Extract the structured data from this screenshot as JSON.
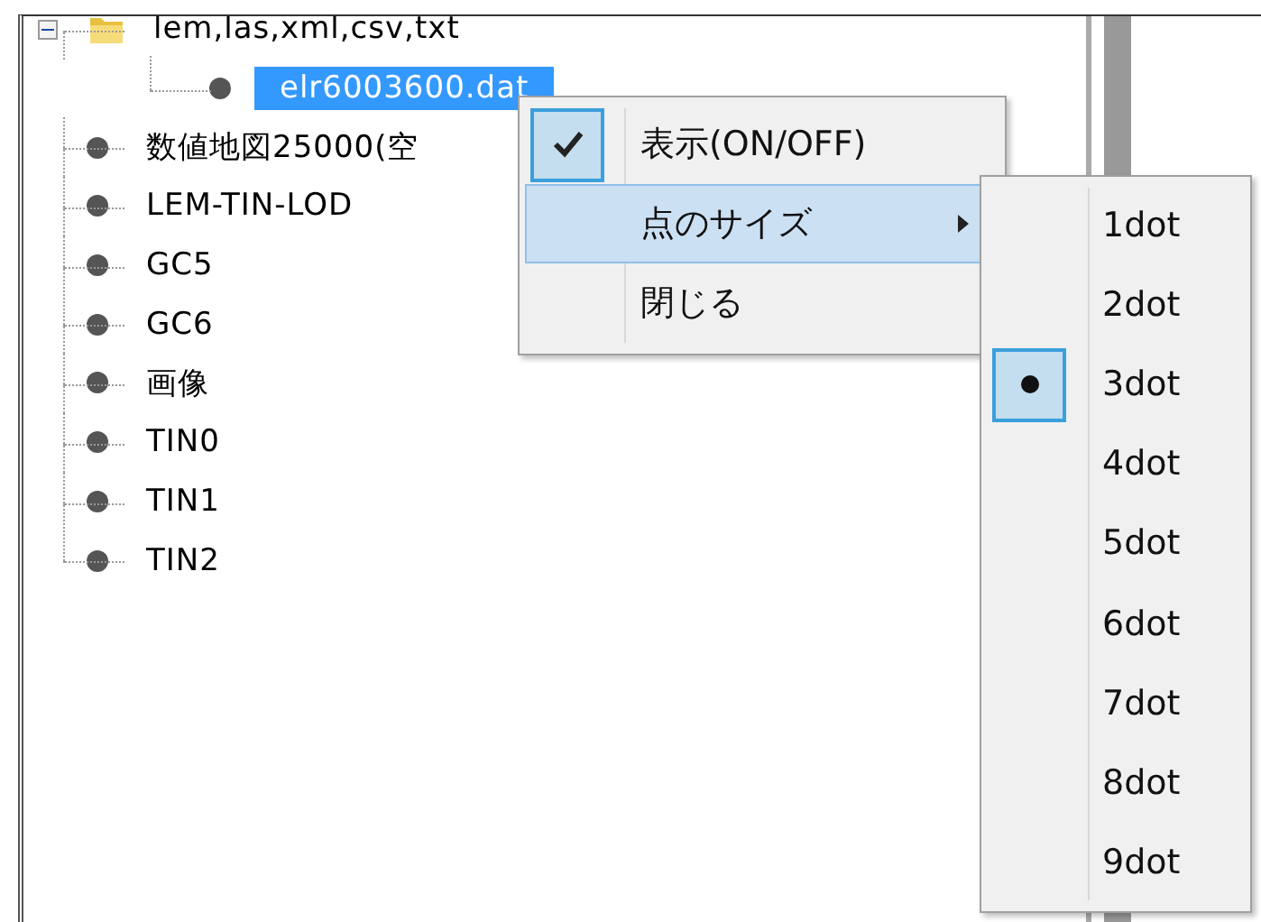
{
  "tree": [
    {
      "kind": "folder",
      "label": "lem,las,xml,csv,txt",
      "expanded": true,
      "selected": false,
      "children": [
        {
          "kind": "layer",
          "label": "elr6003600.dat",
          "selected": true
        }
      ]
    },
    {
      "kind": "layer",
      "label": "数値地図25000(空",
      "selected": false
    },
    {
      "kind": "layer",
      "label": "LEM-TIN-LOD",
      "selected": false
    },
    {
      "kind": "layer",
      "label": "GC5",
      "selected": false
    },
    {
      "kind": "layer",
      "label": "GC6",
      "selected": false
    },
    {
      "kind": "layer",
      "label": "画像",
      "selected": false
    },
    {
      "kind": "layer",
      "label": "TIN0",
      "selected": false
    },
    {
      "kind": "layer",
      "label": "TIN1",
      "selected": false
    },
    {
      "kind": "layer",
      "label": "TIN2",
      "selected": false
    }
  ],
  "context_menu": {
    "items": [
      {
        "label": "表示(ON/OFF)",
        "checked": true,
        "selected": false,
        "submenu": false
      },
      {
        "label": "点のサイズ",
        "checked": false,
        "selected": true,
        "submenu": true
      },
      {
        "label": "閉じる",
        "checked": false,
        "selected": false,
        "submenu": false
      }
    ]
  },
  "submenu": {
    "items": [
      {
        "label": "1dot",
        "selected": false
      },
      {
        "label": "2dot",
        "selected": false
      },
      {
        "label": "3dot",
        "selected": true
      },
      {
        "label": "4dot",
        "selected": false
      },
      {
        "label": "5dot",
        "selected": false
      },
      {
        "label": "6dot",
        "selected": false
      },
      {
        "label": "7dot",
        "selected": false
      },
      {
        "label": "8dot",
        "selected": false
      },
      {
        "label": "9dot",
        "selected": false
      }
    ]
  }
}
